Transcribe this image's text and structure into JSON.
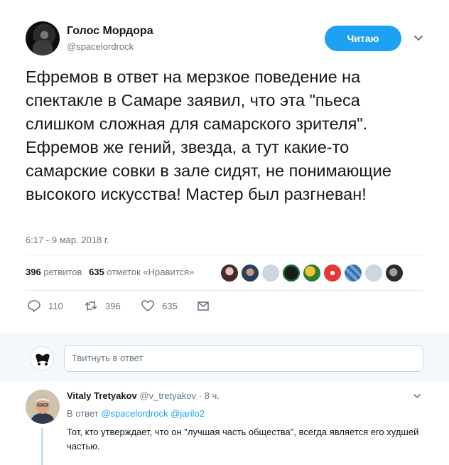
{
  "tweet": {
    "author_name": "Голос Мордора",
    "author_handle": "@spacelordrock",
    "follow_label": "Читаю",
    "text": "Ефремов в ответ на мерзкое поведение на спектакле в Самаре заявил, что эта \"пьеса слишком сложная для самарского зрителя\". Ефремов же гений, звезда, а тут какие-то самарские совки в зале сидят, не понимающие высокого искусства! Мастер был разгневан!",
    "timestamp": "6:17 - 9 мар. 2018 г.",
    "stats": {
      "retweets_count": "396",
      "retweets_label": "ретвитов",
      "likes_count": "635",
      "likes_label": "отметок «Нравится»"
    },
    "actions": {
      "reply_count": "110",
      "retweet_count": "396",
      "like_count": "635"
    }
  },
  "reply_box": {
    "placeholder": "Твитнуть в ответ"
  },
  "reply": {
    "author_name": "Vitaly Tretyakov",
    "author_handle": "@v_tretyakov",
    "time": "· 8 ч.",
    "in_reply_to_label": "В ответ",
    "mention_1": "@spacelordrock",
    "mention_2": "@jarilo2",
    "text": "Тот, кто утверждает, что он \"лучшая часть общества\", всегда является его худшей частью."
  },
  "colors": {
    "accent": "#1da1f2",
    "secondary_text": "#657786",
    "primary_text": "#14171a",
    "divider": "#e6ecf0"
  }
}
